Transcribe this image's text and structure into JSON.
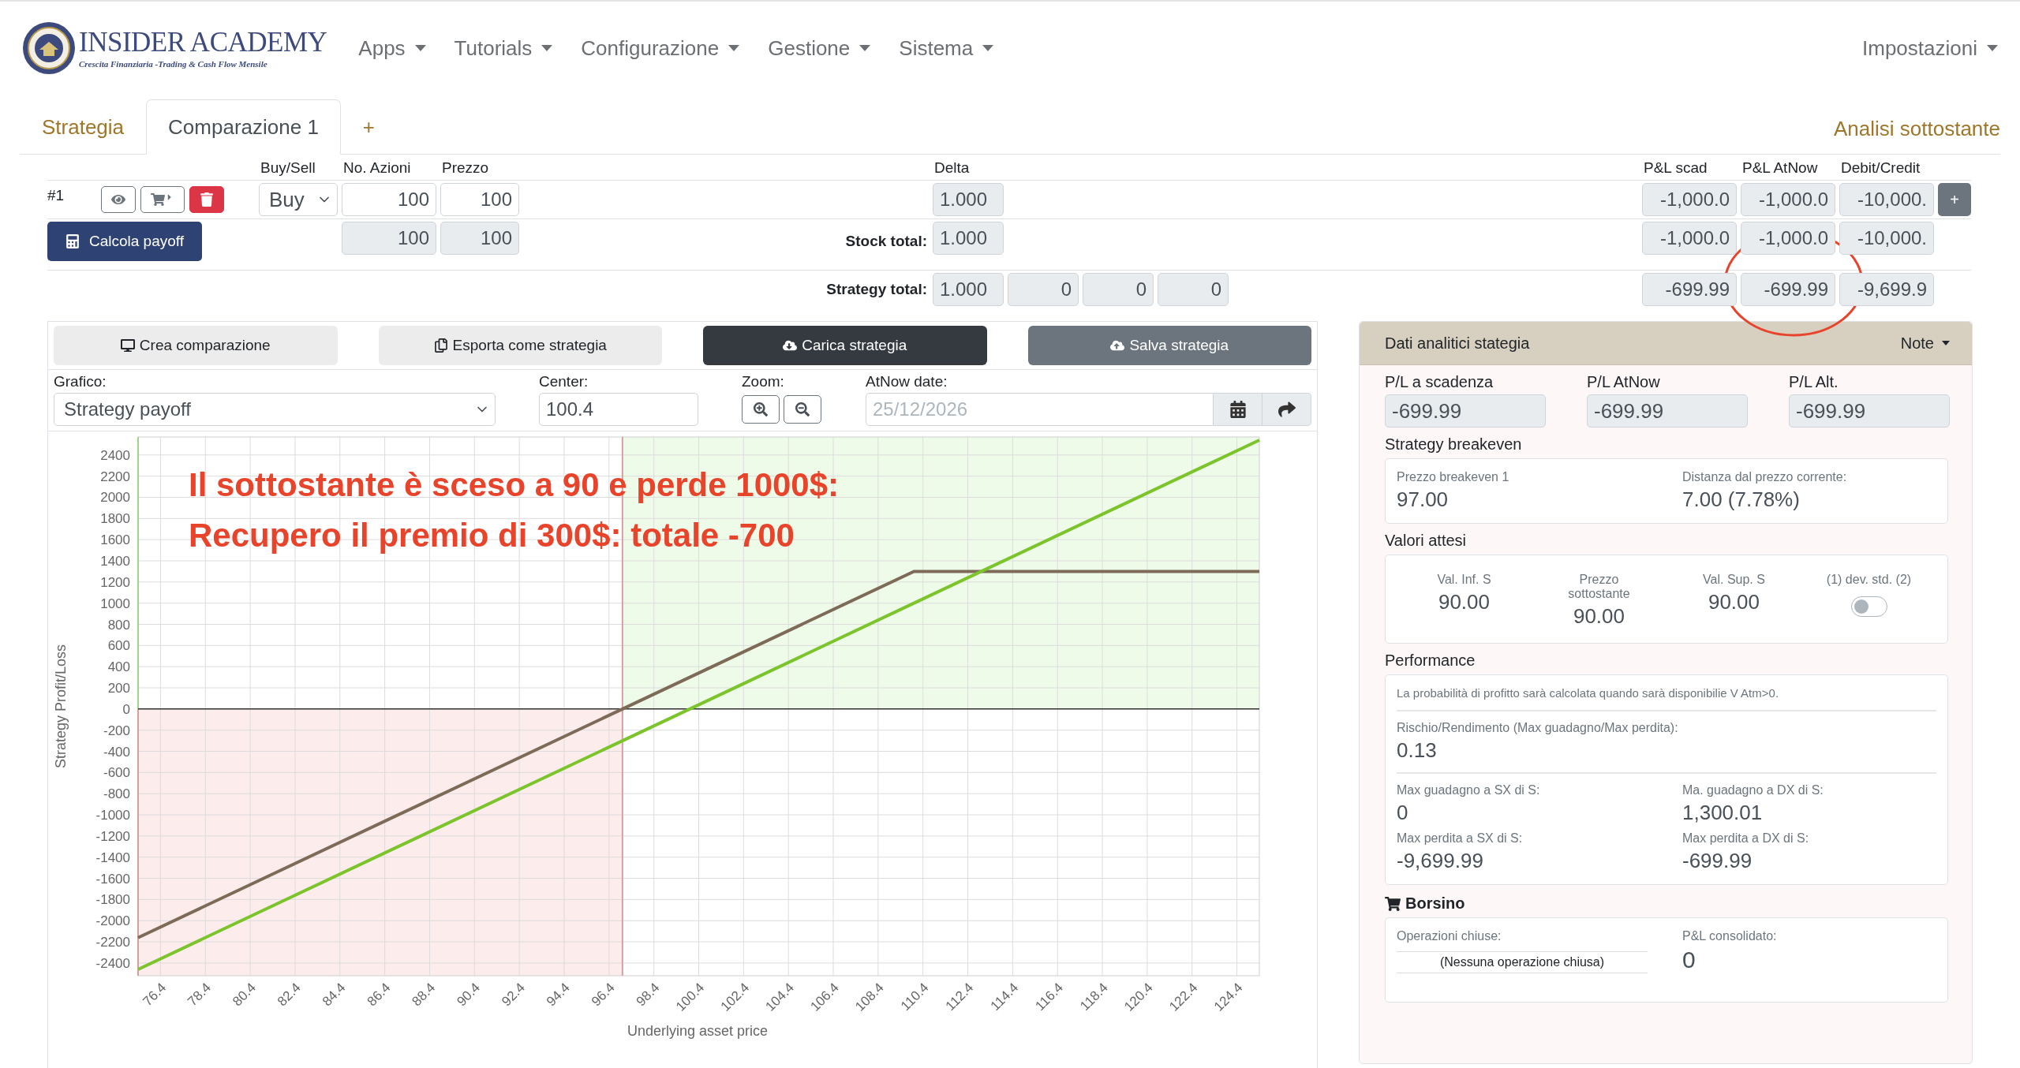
{
  "brand": {
    "name": "INSIDER ACADEMY",
    "tagline": "Crescita Finanziaria -Trading & Cash Flow Mensile"
  },
  "nav": {
    "items": [
      {
        "label": "Apps"
      },
      {
        "label": "Tutorials"
      },
      {
        "label": "Configurazione"
      },
      {
        "label": "Gestione"
      },
      {
        "label": "Sistema"
      }
    ],
    "right": {
      "label": "Impostazioni"
    }
  },
  "tabs": [
    {
      "label": "Strategia",
      "selected": false
    },
    {
      "label": "Comparazione 1",
      "selected": true
    },
    {
      "label": "+",
      "selected": false
    }
  ],
  "tab_link": "Analisi sottostante",
  "legs_table": {
    "columns": [
      "Buy/Sell",
      "No. Azioni",
      "Prezzo",
      "Delta",
      "P&L scad",
      "P&L AtNow",
      "Debit/Credit"
    ],
    "leg": {
      "index": "#1",
      "side": "Buy",
      "shares": "100",
      "price": "100",
      "delta": "1.000",
      "pl_scad": "-1,000.0",
      "pl_atnow": "-1,000.0",
      "debit_credit": "-10,000.",
      "add": "+"
    },
    "calc_button": "Calcola payoff",
    "stock_total": {
      "label": "Stock total:",
      "shares": "100",
      "price": "100",
      "delta": "1.000",
      "pl_scad": "-1,000.0",
      "pl_atnow": "-1,000.0",
      "debit_credit": "-10,000."
    },
    "strategy_total": {
      "label": "Strategy total:",
      "delta": "1.000",
      "greeks": [
        "0",
        "0",
        "0"
      ],
      "pl_scad": "-699.99",
      "pl_atnow": "-699.99",
      "debit_credit": "-9,699.9"
    }
  },
  "chart_panel": {
    "actions": [
      {
        "label": "Crea comparazione",
        "kind": "light"
      },
      {
        "label": "Esporta come strategia",
        "kind": "light"
      },
      {
        "label": "Carica strategia",
        "kind": "dark"
      },
      {
        "label": "Salva strategia",
        "kind": "secondary"
      }
    ],
    "grafico": {
      "label": "Grafico:",
      "value": "Strategy payoff"
    },
    "center": {
      "label": "Center:",
      "value": "100.4"
    },
    "zoom": {
      "label": "Zoom:"
    },
    "atnow": {
      "label": "AtNow date:",
      "placeholder": "25/12/2026"
    },
    "note_lines": [
      "Il sottostante è sceso a 90 e perde 1000$:",
      "Recupero il premio di 300$: totale -700"
    ],
    "chart_data": {
      "type": "line",
      "xlabel": "Underlying asset price",
      "ylabel": "Strategy Profit/Loss",
      "x": [
        75.4,
        97,
        100,
        110,
        125.4
      ],
      "series": [
        {
          "color": "#7d6b57",
          "values": [
            -2160,
            0,
            300,
            1300,
            1300
          ]
        },
        {
          "color": "#7cc42c",
          "values": [
            -2460,
            -300,
            0,
            1000,
            2540
          ]
        }
      ],
      "xlim": [
        75.4,
        125.4
      ],
      "ylim": [
        -2520,
        2570
      ],
      "xticks": [
        76.4,
        78.4,
        80.4,
        82.4,
        84.4,
        86.4,
        88.4,
        90.4,
        92.4,
        94.4,
        96.4,
        98.4,
        100.4,
        102.4,
        104.4,
        106.4,
        108.4,
        110.4,
        112.4,
        114.4,
        116.4,
        118.4,
        120.4,
        122.4,
        124.4
      ],
      "yticks": [
        2400,
        2200,
        2000,
        1800,
        1600,
        1400,
        1200,
        1000,
        800,
        600,
        400,
        200,
        0,
        -200,
        -400,
        -600,
        -800,
        -1000,
        -1200,
        -1400,
        -1600,
        -1800,
        -2000,
        -2200,
        -2400
      ],
      "grid": true,
      "ref_lines": [
        {
          "axis": "x",
          "value": 97,
          "color": "#d4a0a0"
        }
      ]
    }
  },
  "analytics": {
    "title": "Dati analitici stategia",
    "menu": "Note",
    "pl": [
      {
        "label": "P/L a scadenza",
        "value": "-699.99"
      },
      {
        "label": "P/L AtNow",
        "value": "-699.99"
      },
      {
        "label": "P/L Alt.",
        "value": "-699.99"
      }
    ],
    "breakeven": {
      "title": "Strategy breakeven",
      "items": [
        {
          "label": "Prezzo breakeven 1",
          "value": "97.00"
        },
        {
          "label": "Distanza dal prezzo corrente:",
          "value": "7.00 (7.78%)"
        }
      ]
    },
    "expected": {
      "title": "Valori attesi",
      "items": [
        {
          "label": "Val. Inf. S",
          "value": "90.00"
        },
        {
          "label": "Prezzo sottostante",
          "value": "90.00"
        },
        {
          "label": "Val. Sup. S",
          "value": "90.00"
        }
      ],
      "toggle": {
        "label": "(1) dev. std. (2)",
        "on": false
      }
    },
    "performance": {
      "title": "Performance",
      "note": "La probabilità di profitto sarà calcolata quando sarà disponibilie V Atm>0.",
      "ratio": {
        "label": "Rischio/Rendimento (Max guadagno/Max perdita):",
        "value": "0.13"
      },
      "stats": [
        {
          "label": "Max guadagno a SX di S:",
          "value": "0"
        },
        {
          "label": "Ma. guadagno a DX di S:",
          "value": "1,300.01"
        },
        {
          "label": "Max perdita a SX di S:",
          "value": "-9,699.99"
        },
        {
          "label": "Max perdita a DX di S:",
          "value": "-699.99"
        }
      ]
    },
    "borsino": {
      "title": "Borsino",
      "closed_label": "Operazioni chiuse:",
      "closed_empty": "(Nessuna operazione chiusa)",
      "pl_label": "P&L consolidato:",
      "pl_value": "0"
    }
  }
}
